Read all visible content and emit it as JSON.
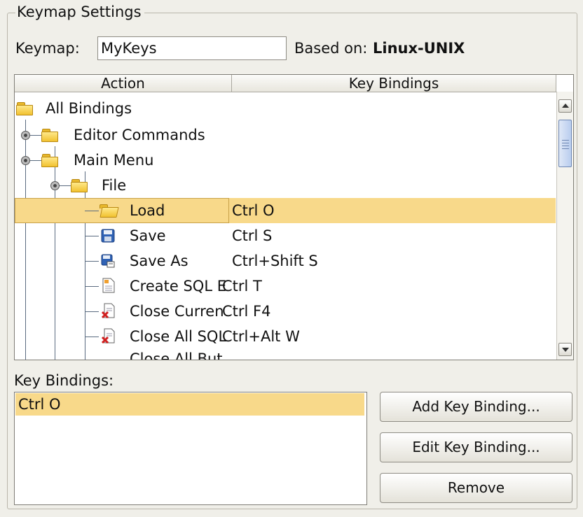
{
  "group_title": "Keymap Settings",
  "keymap": {
    "label": "Keymap:",
    "value": "MyKeys",
    "based_on_label": "Based on:",
    "based_on_value": "Linux-UNIX"
  },
  "table": {
    "columns": [
      "Action",
      "Key Bindings"
    ],
    "rows": [
      {
        "label": "All Bindings",
        "binding": "",
        "icon": "folder-icon"
      },
      {
        "label": "Editor Commands",
        "binding": "",
        "icon": "folder-icon"
      },
      {
        "label": "Main Menu",
        "binding": "",
        "icon": "folder-icon"
      },
      {
        "label": "File",
        "binding": "",
        "icon": "folder-icon"
      },
      {
        "label": "Load",
        "binding": "Ctrl O",
        "icon": "open-folder-icon"
      },
      {
        "label": "Save",
        "binding": "Ctrl S",
        "icon": "save-icon"
      },
      {
        "label": "Save As",
        "binding": "Ctrl+Shift S",
        "icon": "save-as-icon"
      },
      {
        "label": "Create SQL E",
        "binding": "Ctrl T",
        "icon": "new-document-icon"
      },
      {
        "label": "Close Curren",
        "binding": "Ctrl F4",
        "icon": "close-document-icon"
      },
      {
        "label": "Close All SQL",
        "binding": "Ctrl+Alt W",
        "icon": "close-document-icon"
      },
      {
        "label": "Close All But",
        "binding": "",
        "icon": "close-document-icon"
      }
    ]
  },
  "key_bindings": {
    "label": "Key Bindings:",
    "items": [
      "Ctrl O"
    ]
  },
  "buttons": {
    "add": "Add Key Binding...",
    "edit": "Edit Key Binding...",
    "remove": "Remove"
  },
  "colors": {
    "selection": "#f8d98a",
    "background": "#f0efe9"
  }
}
